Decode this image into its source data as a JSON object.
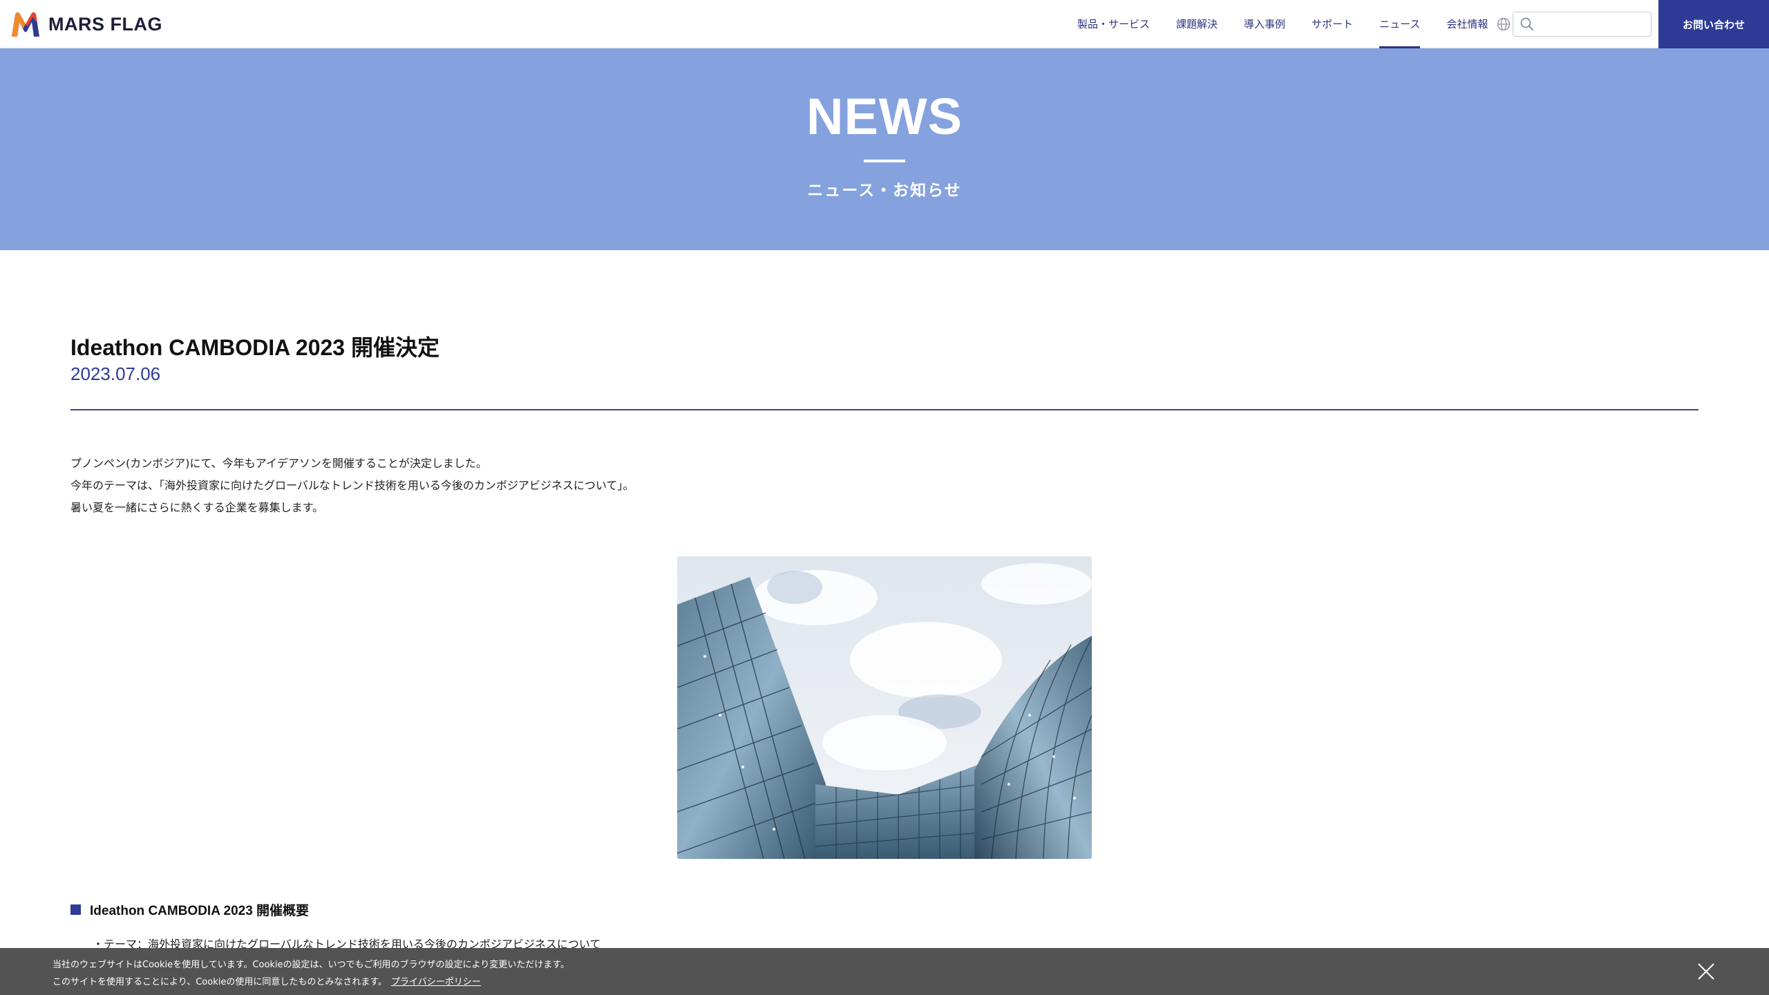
{
  "header": {
    "logo_text": "MARS FLAG",
    "nav": [
      {
        "label": "製品・サービス"
      },
      {
        "label": "課題解決"
      },
      {
        "label": "導入事例"
      },
      {
        "label": "サポート"
      },
      {
        "label": "ニュース",
        "active": true
      },
      {
        "label": "会社情報"
      }
    ],
    "language_icon": "globe-icon",
    "search": {
      "value": "",
      "placeholder": "",
      "icon": "search-icon"
    },
    "contact_label": "お問い合わせ"
  },
  "hero": {
    "title": "NEWS",
    "subtitle": "ニュース・お知らせ"
  },
  "article": {
    "title": "Ideathon CAMBODIA 2023 開催決定",
    "date": "2023.07.06",
    "paragraphs": [
      "プノンペン(カンボジア)にて、今年もアイデアソンを開催することが決定しました。",
      "今年のテーマは、「海外投資家に向けたグローバルなトレンド技術を用いる今後のカンボジアビジネスについて」。",
      "暑い夏を一緒にさらに熱くする企業を募集します。"
    ],
    "image_icon": "glass-building-photo",
    "section_heading": "Ideathon CAMBODIA 2023 開催概要",
    "list_items": [
      "・テーマ：海外投資家に向けたグローバルなトレンド技術を用いる今後のカンボジアビジネスについて"
    ]
  },
  "cookie": {
    "line1": "当社のウェブサイトはCookieを使用しています。Cookieの設定は、いつでもご利用のブラウザの設定により変更いただけます。",
    "line2": "このサイトを使用することにより、Cookieの使用に同意したものとみなされます。",
    "link": "プライバシーポリシー",
    "close_icon": "close-icon"
  },
  "colors": {
    "brand_navy": "#2d3a96",
    "hero_blue": "#85a2df",
    "cookie_bg": "#484848"
  }
}
